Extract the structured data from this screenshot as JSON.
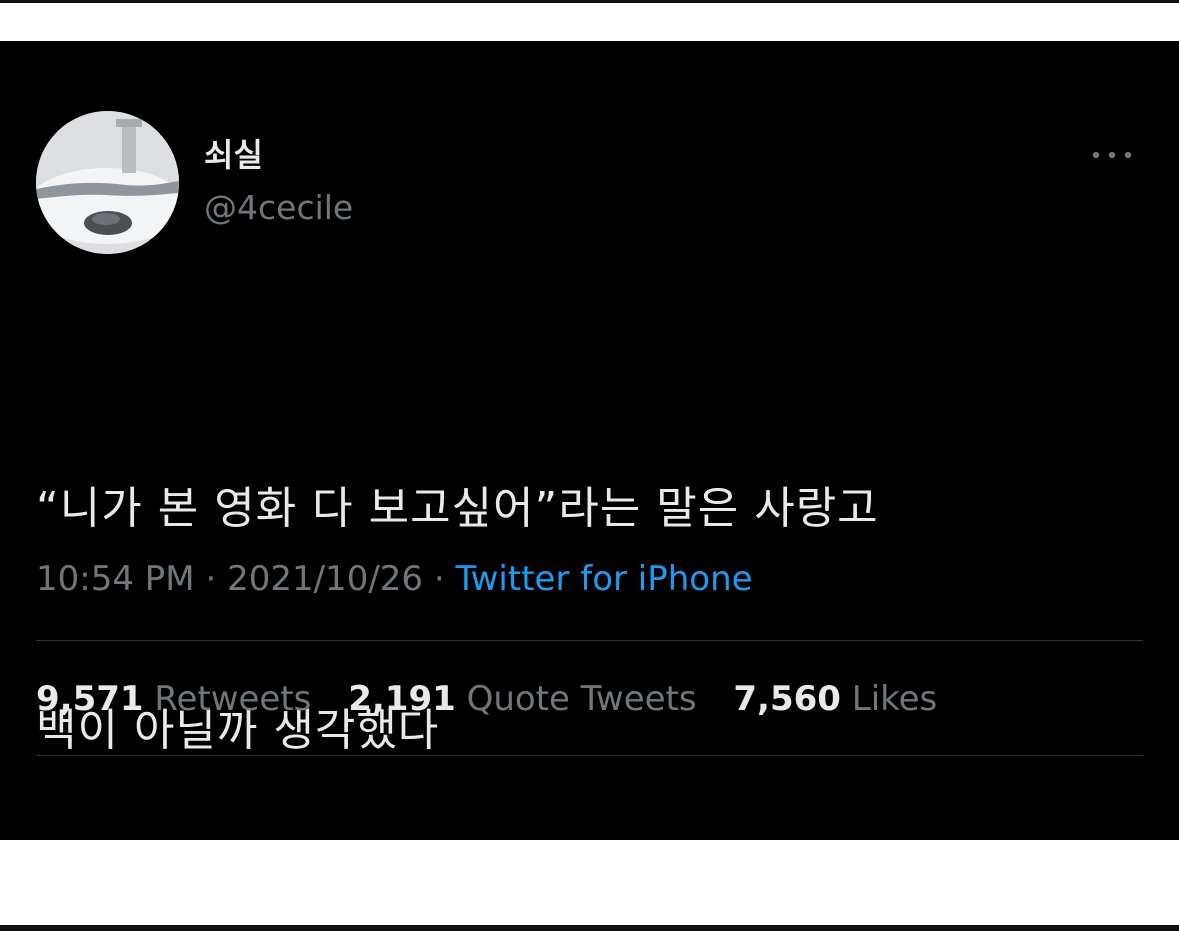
{
  "tweet": {
    "display_name": "쇠실",
    "username": "@4cecile",
    "text_line1": "“니가 본 영화 다 보고싶어”라는 말은 사랑고",
    "text_line2": "백이 아닐까 생각했다",
    "time": "10:54 PM",
    "separator": "·",
    "date": "2021/10/26",
    "source": "Twitter for iPhone"
  },
  "stats": [
    {
      "count": "9,571",
      "label": "Retweets"
    },
    {
      "count": "2,191",
      "label": "Quote Tweets"
    },
    {
      "count": "7,560",
      "label": "Likes"
    }
  ],
  "icons": {
    "more": "more-horizontal-icon",
    "avatar": "profile-photo"
  },
  "colors": {
    "background": "#000000",
    "text_primary": "#e7e9ea",
    "text_secondary": "#71767b",
    "link": "#1d9bf0",
    "divider": "#2f3336"
  }
}
